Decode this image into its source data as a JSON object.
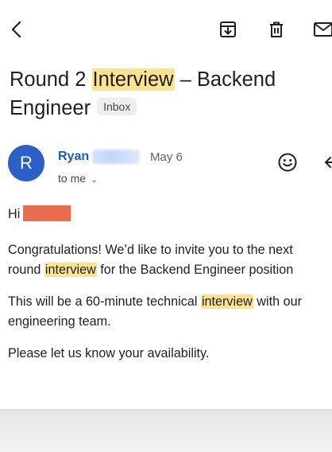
{
  "toolbar": {
    "icons": [
      "back-arrow-icon",
      "archive-icon",
      "delete-icon",
      "mark-unread-icon"
    ]
  },
  "email": {
    "subject_parts": [
      "Round 2 ",
      "Interview",
      " – Backend Engineer"
    ],
    "label": "Inbox",
    "sender": {
      "avatar_initial": "R",
      "name": "Ryan",
      "date": "May 6",
      "recipient": "to me"
    },
    "body": {
      "greeting": "Hi",
      "p1": {
        "part1": "Congratulations! We’d like to invite you to the next",
        "part2": "round ",
        "highlight": "interview",
        "part3": " for the Backend Engineer position"
      },
      "p2": {
        "part1": "This will be a 60-minute technical ",
        "highlight": "interview",
        "part2": " with our",
        "part3": "engineering team."
      },
      "p3": "Please let us know your availability."
    }
  },
  "colors": {
    "accent": "#1a57c4",
    "avatar": "#2d5fc8",
    "highlight": "#fde293",
    "redaction": "#ea6c4f"
  }
}
